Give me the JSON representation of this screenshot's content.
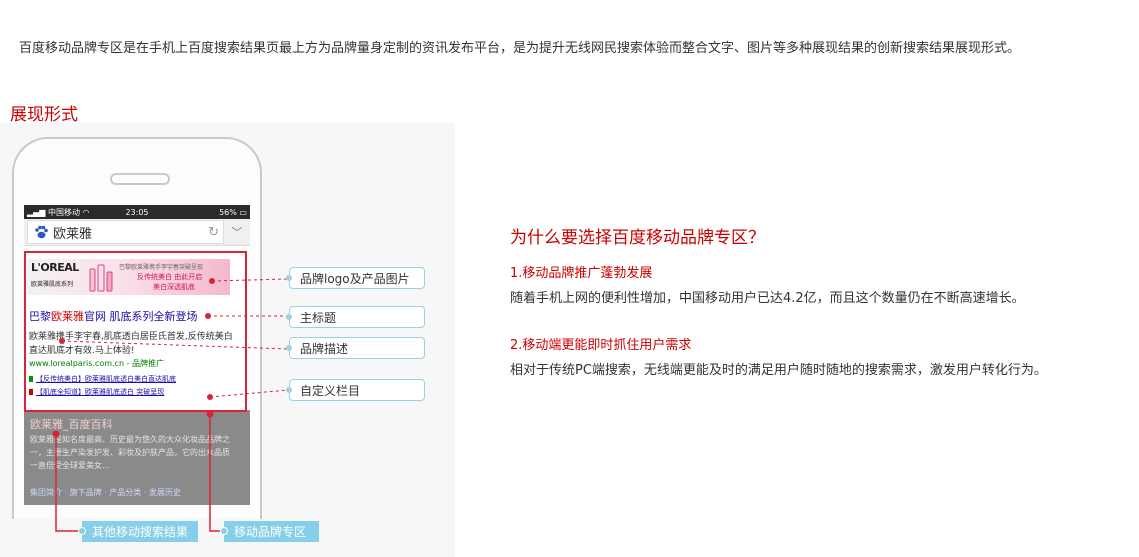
{
  "intro": "百度移动品牌专区是在手机上百度搜索结果页最上方为品牌量身定制的资讯发布平台，是为提升无线网民搜索体验而整合文字、图片等多种展现结果的创新搜索结果展现形式。",
  "display_section": {
    "title": "展现形式"
  },
  "phone": {
    "status": {
      "carrier": "中国移动",
      "time": "23:05",
      "battery": "56%"
    },
    "search_query": "欧莱雅",
    "brand_ad": {
      "banner_logo": "L'OREAL",
      "banner_logo_sub": "欧莱雅肌底系列",
      "banner_line1": "巴黎欧莱雅携手李宇春突破呈现",
      "banner_line2": "反传统美白 由此开启",
      "banner_line3": "美白深透肌底",
      "title_prefix": "巴黎",
      "title_highlight": "欧莱雅",
      "title_suffix": "官网 肌底系列全新登场",
      "description": "欧莱雅携手李宇春,肌底透白居臣氏首发,反传统美白直达肌底才有效.马上体验!",
      "url": "www.lorealparis.com.cn - 品牌推广",
      "link1": "【反传统美白】欧莱雅肌底透白美白直达肌底",
      "link2": "【肌底全知道】欧莱雅肌底透白 突破呈现"
    },
    "other_result": {
      "title": "欧莱雅_百度百科",
      "description": "欧莱雅是知名度最高、历史最为悠久的大众化妆品品牌之一，主要生产染发护发、彩妆及护肤产品，它的出众品质一直倍受全球爱美女...",
      "links": "集团简介 · 旗下品牌 · 产品分类 · 发展历史"
    }
  },
  "callouts": {
    "logo": "品牌logo及产品图片",
    "title": "主标题",
    "desc": "品牌描述",
    "custom": "自定义栏目"
  },
  "bottom_labels": {
    "other": "其他移动搜索结果",
    "brand": "移动品牌专区"
  },
  "why": {
    "title": "为什么要选择百度移动品牌专区？",
    "points": [
      {
        "title": "1.移动品牌推广蓬勃发展",
        "body": "随着手机上网的便利性增加，中国移动用户已达4.2亿，而且这个数量仍在不断高速增长。"
      },
      {
        "title": "2.移动端更能即时抓住用户需求",
        "body": "相对于传统PC端搜索，无线端更能及时的满足用户随时随地的搜索需求，激发用户转化行为。"
      }
    ]
  },
  "colors": {
    "accent_red": "#cc0000",
    "callout_blue": "#9ecfe3",
    "frame_red": "#d9233a"
  }
}
